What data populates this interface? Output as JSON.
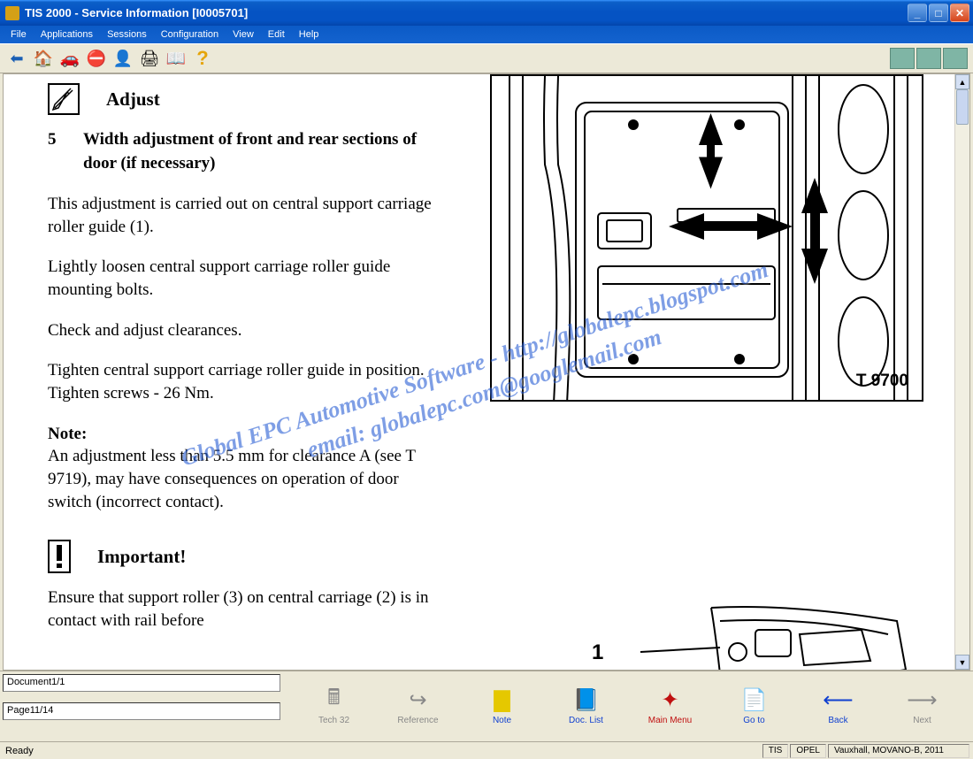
{
  "window": {
    "title": "TIS 2000 - Service Information [I0005701]"
  },
  "menu": {
    "file": "File",
    "applications": "Applications",
    "sessions": "Sessions",
    "configuration": "Configuration",
    "view": "View",
    "edit": "Edit",
    "help": "Help"
  },
  "doc": {
    "adjust_title": "Adjust",
    "step_num": "5",
    "step_title": "Width adjustment of front and rear sections of door (if necessary)",
    "p1": "This adjustment is carried out on central support carriage roller guide (1).",
    "p2": "Lightly loosen central support carriage roller guide mounting bolts.",
    "p3": "Check and adjust clearances.",
    "p4": "Tighten central support carriage roller guide in position. Tighten screws - 26 Nm.",
    "note_label": "Note:",
    "note_text": "An adjustment less than 5.5 mm for clearance A (see T 9719), may have consequences on operation of door switch (incorrect contact).",
    "important_title": "Important!",
    "p5": "Ensure that support roller (3) on central carriage (2) is in contact with rail before",
    "diagram_label": "T 9700",
    "callout1": "1"
  },
  "watermark": {
    "line1": "Global EPC Automotive Software - http://globalepc.blogspot.com",
    "line2": "email: globalepc.com@googlemail.com"
  },
  "footer": {
    "doc_info": "Document1/1",
    "page_info": "Page11/14",
    "btn_tech32": "Tech 32",
    "btn_reference": "Reference",
    "btn_note": "Note",
    "btn_doclist": "Doc. List",
    "btn_mainmenu": "Main Menu",
    "btn_goto": "Go to",
    "btn_back": "Back",
    "btn_next": "Next"
  },
  "status": {
    "ready": "Ready",
    "tis": "TIS",
    "opel": "OPEL",
    "vehicle": "Vauxhall, MOVANO-B, 2011"
  }
}
